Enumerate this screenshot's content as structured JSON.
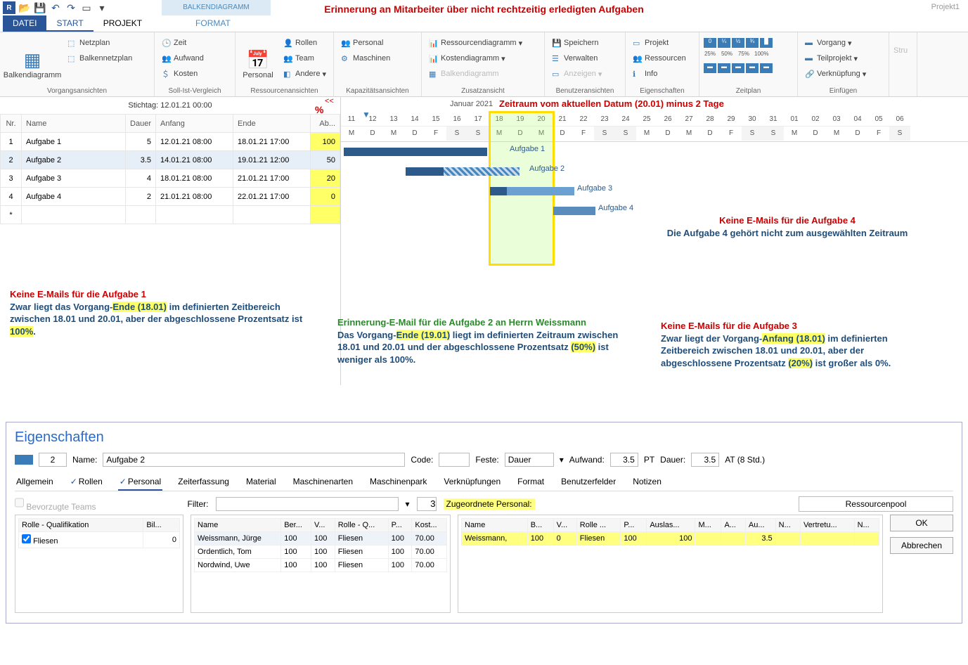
{
  "title_banner": "Erinnerung an Mitarbeiter über nicht rechtzeitig erledigten Aufgaben",
  "project_name": "Projekt1",
  "contextual_tab": "BALKENDIAGRAMM",
  "tabs": {
    "file": "DATEI",
    "start": "START",
    "projekt": "PROJEKT",
    "format": "FORMAT"
  },
  "ribbon": {
    "g1": {
      "label": "Vorgangsansichten",
      "big": "Balkendiagramm",
      "b1": "Netzplan",
      "b2": "Balkennetzplan"
    },
    "g2": {
      "label": "Soll-Ist-Vergleich",
      "b1": "Zeit",
      "b2": "Aufwand",
      "b3": "Kosten"
    },
    "g3": {
      "label": "Ressourcenansichten",
      "big": "Personal",
      "b1": "Rollen",
      "b2": "Team",
      "b3": "Andere"
    },
    "g4": {
      "label": "Kapazitätsansichten",
      "b1": "Personal",
      "b2": "Maschinen"
    },
    "g5": {
      "label": "Zusatzansicht",
      "b1": "Ressourcendiagramm",
      "b2": "Kostendiagramm",
      "b3": "Balkendiagramm"
    },
    "g6": {
      "label": "Benutzeransichten",
      "b1": "Speichern",
      "b2": "Verwalten",
      "b3": "Anzeigen"
    },
    "g7": {
      "label": "Eigenschaften",
      "b1": "Projekt",
      "b2": "Ressourcen",
      "b3": "Info"
    },
    "g8": {
      "label": "Zeitplan",
      "p25": "25%",
      "p50": "50%",
      "p75": "75%",
      "p100": "100%"
    },
    "g9": {
      "label": "Einfügen",
      "b1": "Vorgang",
      "b2": "Teilprojekt",
      "b3": "Verknüpfung"
    }
  },
  "stichtag": "Stichtag: 12.01.21 00:00",
  "pct_header": "%",
  "collapse": "<<",
  "task_headers": {
    "nr": "Nr.",
    "name": "Name",
    "dauer": "Dauer",
    "anfang": "Anfang",
    "ende": "Ende",
    "ab": "Ab..."
  },
  "tasks": [
    {
      "nr": "1",
      "name": "Aufgabe 1",
      "dauer": "5",
      "anfang": "12.01.21 08:00",
      "ende": "18.01.21 17:00",
      "pct": "100"
    },
    {
      "nr": "2",
      "name": "Aufgabe 2",
      "dauer": "3.5",
      "anfang": "14.01.21 08:00",
      "ende": "19.01.21 12:00",
      "pct": "50"
    },
    {
      "nr": "3",
      "name": "Aufgabe 3",
      "dauer": "4",
      "anfang": "18.01.21 08:00",
      "ende": "21.01.21 17:00",
      "pct": "20"
    },
    {
      "nr": "4",
      "name": "Aufgabe 4",
      "dauer": "2",
      "anfang": "21.01.21 08:00",
      "ende": "22.01.21 17:00",
      "pct": "0"
    }
  ],
  "gantt": {
    "month": "Januar 2021",
    "range_note": "Zeitraum vom aktuellen Datum (20.01) minus 2 Tage",
    "days": [
      "11",
      "12",
      "13",
      "14",
      "15",
      "16",
      "17",
      "18",
      "19",
      "20",
      "21",
      "22",
      "23",
      "24",
      "25",
      "26",
      "27",
      "28",
      "29",
      "30",
      "31",
      "01",
      "02",
      "03",
      "04",
      "05",
      "06"
    ],
    "dow": [
      "M",
      "D",
      "M",
      "D",
      "F",
      "S",
      "S",
      "M",
      "D",
      "M",
      "D",
      "F",
      "S",
      "S",
      "M",
      "D",
      "M",
      "D",
      "F",
      "S",
      "S",
      "M",
      "D",
      "M",
      "D",
      "F",
      "S"
    ],
    "labels": {
      "a1": "Aufgabe 1",
      "a2": "Aufgabe 2",
      "a3": "Aufgabe 3",
      "a4": "Aufgabe 4"
    }
  },
  "annotations": {
    "a1_title": "Keine E-Mails für die Aufgabe 1",
    "a1_body1": "Zwar liegt das Vorgang-",
    "a1_body1b": "Ende (18.01)",
    "a1_body1c": " im definierten Zeitbereich zwischen 18.01 und 20.01, aber der abgeschlossene Prozentsatz ist ",
    "a1_body1d": "100%",
    "a1_body1e": ".",
    "a2_title": "Erinnerung-E-Mail für die Aufgabe 2 an Herrn Weissmann",
    "a2_body1": "Das Vorgang-",
    "a2_body1b": "Ende (19.01)",
    "a2_body1c": " liegt im definierten Zeitraum zwischen 18.01 und 20.01 und der abgeschlossene Prozentsatz ",
    "a2_body1d": "(50%)",
    "a2_body1e": " ist weniger als 100%.",
    "a3_title": "Keine E-Mails für die Aufgabe 3",
    "a3_body1": "Zwar liegt der Vorgang-",
    "a3_body1b": "Anfang (18.01)",
    "a3_body1c": " im definierten Zeitbereich zwischen 18.01 und 20.01, aber der abgeschlossene Prozentsatz ",
    "a3_body1d": "(20%)",
    "a3_body1e": " ist großer als 0%.",
    "a4_title": "Keine E-Mails für die Aufgabe 4",
    "a4_body": "Die Aufgabe 4 gehört nicht zum ausgewählten Zeitraum"
  },
  "props": {
    "title": "Eigenschaften",
    "id": "2",
    "name_label": "Name:",
    "name": "Aufgabe 2",
    "code_label": "Code:",
    "code": "",
    "feste_label": "Feste:",
    "feste": "Dauer",
    "aufwand_label": "Aufwand:",
    "aufwand": "3.5",
    "aufwand_unit": "PT",
    "dauer_label": "Dauer:",
    "dauer": "3.5",
    "dauer_unit": "AT (8 Std.)",
    "tabs": {
      "allg": "Allgemein",
      "rollen": "Rollen",
      "personal": "Personal",
      "zeit": "Zeiterfassung",
      "mat": "Material",
      "masch1": "Maschinenarten",
      "masch2": "Maschinenpark",
      "ver": "Verknüpfungen",
      "format": "Format",
      "benu": "Benutzerfelder",
      "notiz": "Notizen"
    },
    "bevorzugte": "Bevorzugte Teams",
    "filter_label": "Filter:",
    "filter_num": "3",
    "zugeordnete": "Zugeordnete Personal:",
    "rpool": "Ressourcenpool",
    "role_h1": "Rolle - Qualifikation",
    "role_h2": "Bil...",
    "role_r1": "Fliesen",
    "role_v1": "0",
    "pool_h": {
      "name": "Name",
      "ber": "Ber...",
      "v": "V...",
      "rolle": "Rolle - Q...",
      "p": "P...",
      "kost": "Kost..."
    },
    "pool": [
      {
        "name": "Weissmann, Jürge",
        "ber": "100",
        "v": "100",
        "rolle": "Fliesen",
        "p": "100",
        "kost": "70.00"
      },
      {
        "name": "Ordentlich, Tom",
        "ber": "100",
        "v": "100",
        "rolle": "Fliesen",
        "p": "100",
        "kost": "70.00"
      },
      {
        "name": "Nordwind, Uwe",
        "ber": "100",
        "v": "100",
        "rolle": "Fliesen",
        "p": "100",
        "kost": "70.00"
      }
    ],
    "assign_h": {
      "name": "Name",
      "b": "B...",
      "v": "V...",
      "rolle": "Rolle ...",
      "p": "P...",
      "auslas": "Auslas...",
      "m": "M...",
      "a": "A...",
      "au": "Au...",
      "n": "N...",
      "vertr": "Vertretu...",
      "n2": "N..."
    },
    "assign": {
      "name": "Weissmann,",
      "b": "100",
      "v": "0",
      "rolle": "Fliesen",
      "p": "100",
      "auslas": "100",
      "au": "3.5"
    },
    "ok": "OK",
    "cancel": "Abbrechen"
  }
}
